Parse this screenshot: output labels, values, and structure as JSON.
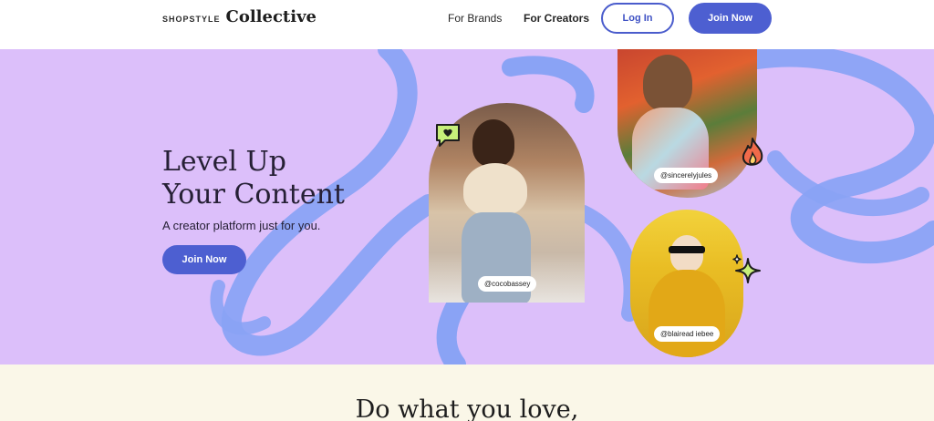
{
  "header": {
    "logo_small": "SHOPSTYLE",
    "logo_big": "Collective",
    "nav": [
      "For Brands",
      "For Creators"
    ],
    "login_label": "Log In",
    "join_label": "Join Now"
  },
  "hero": {
    "title_line1": "Level Up",
    "title_line2": "Your Content",
    "subtitle": "A creator platform just for you.",
    "join_label": "Join Now",
    "handles": [
      "@cocobassey",
      "@sincerelyjules",
      "@blairead iebee"
    ]
  },
  "bottom": {
    "title": "Do what you love,"
  },
  "colors": {
    "hero_bg": "#dcbffa",
    "accent": "#4d5fd1",
    "swoosh": "#8aa3f5",
    "bottom_bg": "#faf7e8"
  },
  "icons": [
    "heart-chat-icon",
    "fire-icon",
    "sparkle-icon"
  ]
}
